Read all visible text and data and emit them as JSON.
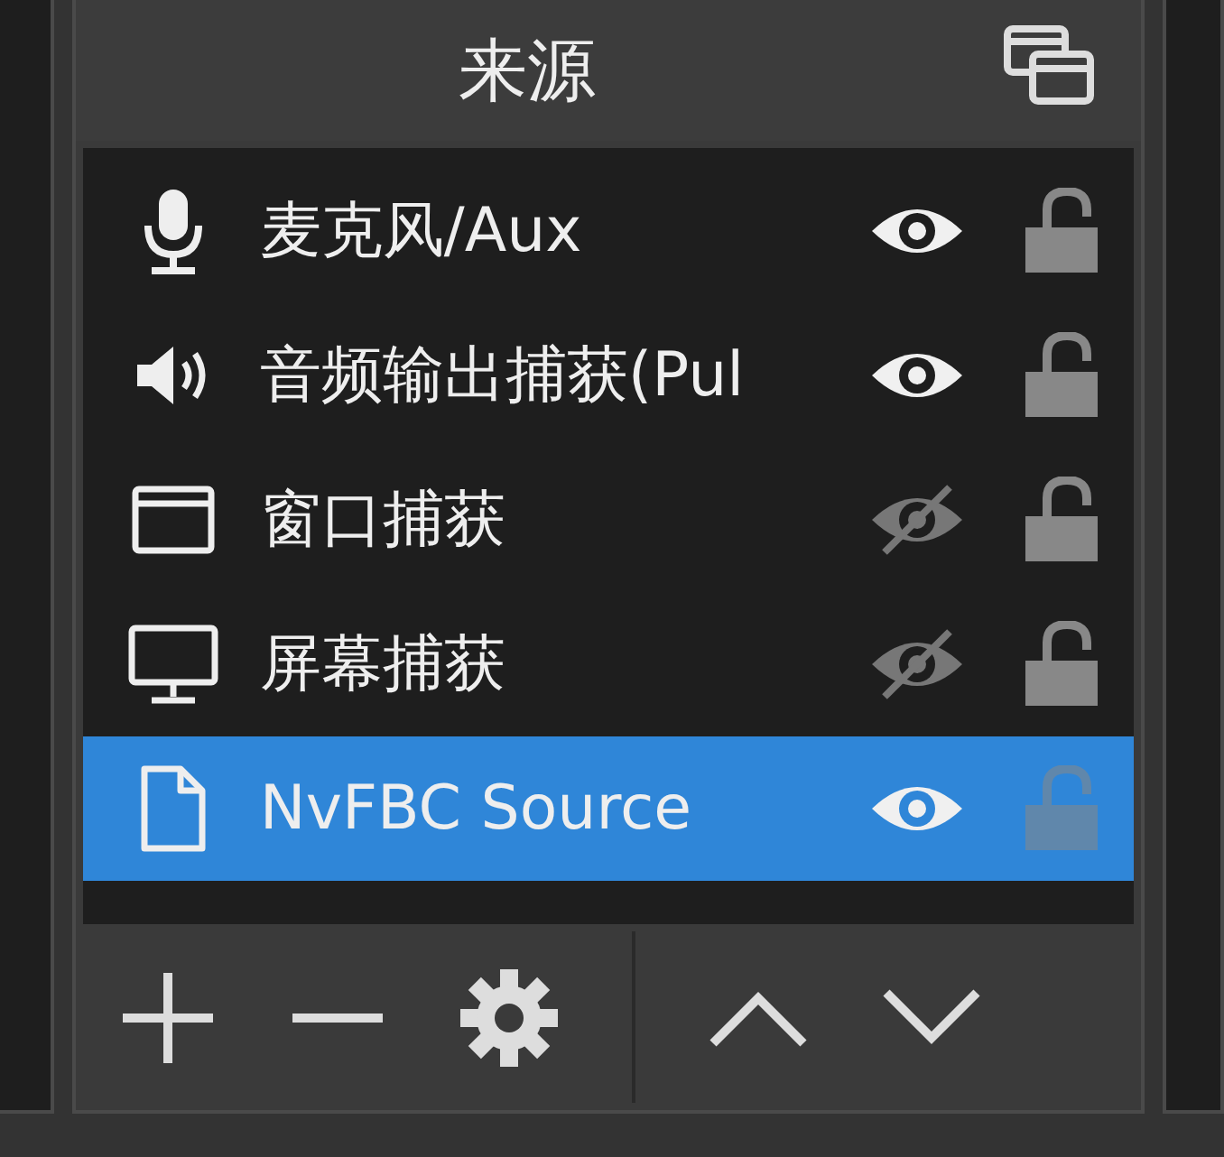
{
  "panel": {
    "title": "来源"
  },
  "sources": [
    {
      "name": "麦克风/Aux",
      "kind": "mic",
      "visible": true,
      "locked": false,
      "selected": false
    },
    {
      "name": "音频输出捕获(Pul",
      "kind": "speaker",
      "visible": true,
      "locked": false,
      "selected": false
    },
    {
      "name": "窗口捕获",
      "kind": "window",
      "visible": false,
      "locked": false,
      "selected": false
    },
    {
      "name": "屏幕捕获",
      "kind": "monitor",
      "visible": false,
      "locked": false,
      "selected": false
    },
    {
      "name": "NvFBC Source",
      "kind": "file",
      "visible": true,
      "locked": false,
      "selected": true
    }
  ]
}
